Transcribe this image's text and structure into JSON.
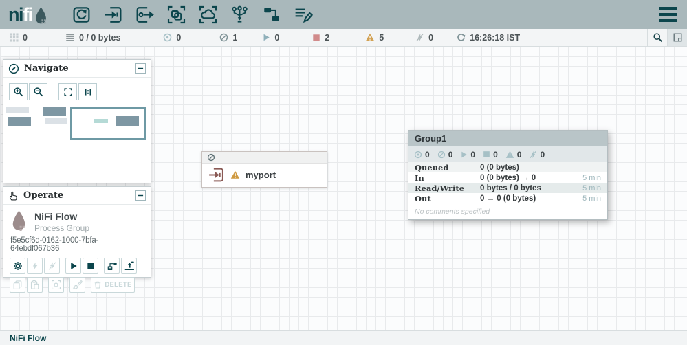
{
  "colors": {
    "toolbar_bg": "#a9b8bb",
    "accent_teal": "#0b454c",
    "stopped_red": "#d18b8b",
    "warning_amber": "#d2a254",
    "port_icon": "#8a5a55",
    "group_header_bg": "#b9c5c8"
  },
  "header": {
    "logo": {
      "ni": "ni",
      "fi": "fi",
      "drop_icon": "nifi-drop-icon"
    },
    "tools": [
      {
        "icon": "processor-icon"
      },
      {
        "icon": "input-port-icon"
      },
      {
        "icon": "output-port-icon"
      },
      {
        "icon": "process-group-icon"
      },
      {
        "icon": "remote-process-group-icon"
      },
      {
        "icon": "funnel-icon"
      },
      {
        "icon": "template-icon"
      },
      {
        "icon": "label-icon"
      }
    ],
    "menu_icon": "hamburger-menu-icon"
  },
  "statusbar": {
    "active_threads": "0",
    "queued": "0 / 0 bytes",
    "transmitting": "0",
    "not_transmitting": "1",
    "running": "0",
    "stopped": "2",
    "warnings": "5",
    "invalid": "0",
    "refresh_time": "16:26:18 IST",
    "icons": [
      "threads-grid-icon",
      "queue-list-icon",
      "transmitting-icon",
      "not-transmitting-icon",
      "running-icon",
      "stopped-icon",
      "warning-icon",
      "invalid-icon",
      "refresh-icon",
      "search-icon",
      "panel-icon"
    ]
  },
  "navigate": {
    "title": "Navigate",
    "tools": [
      "zoom-in",
      "zoom-out",
      "fit",
      "actual-size"
    ]
  },
  "operate": {
    "title": "Operate",
    "flow_name": "NiFi Flow",
    "flow_type": "Process Group",
    "flow_id": "f5e5cf6d-0162-1000-7bfa-64ebdf067b36",
    "delete_label": "DELETE",
    "buttons_row1": [
      "configuration",
      "enable",
      "disable",
      "start",
      "stop",
      "create-template",
      "upload-template"
    ],
    "buttons_row2": [
      "copy",
      "paste",
      "group",
      "color",
      "delete"
    ]
  },
  "port": {
    "name": "myport",
    "state_icon": "not-transmitting-icon",
    "alert_icon": "warning-icon"
  },
  "group": {
    "name": "Group1",
    "counters": [
      {
        "name": "transmitting",
        "value": "0"
      },
      {
        "name": "not-transmitting",
        "value": "0"
      },
      {
        "name": "running",
        "value": "0"
      },
      {
        "name": "stopped",
        "value": "0"
      },
      {
        "name": "warning",
        "value": "0"
      },
      {
        "name": "invalid",
        "value": "0"
      }
    ],
    "stats": [
      {
        "label": "Queued",
        "value": "0 (0 bytes)",
        "time": ""
      },
      {
        "label": "In",
        "value": "0 (0 bytes) → 0",
        "time": "5 min"
      },
      {
        "label": "Read/Write",
        "value": "0 bytes / 0 bytes",
        "time": "5 min"
      },
      {
        "label": "Out",
        "value": "0 → 0 (0 bytes)",
        "time": "5 min"
      }
    ],
    "comments": "No comments specified"
  },
  "breadcrumb": "NiFi Flow"
}
